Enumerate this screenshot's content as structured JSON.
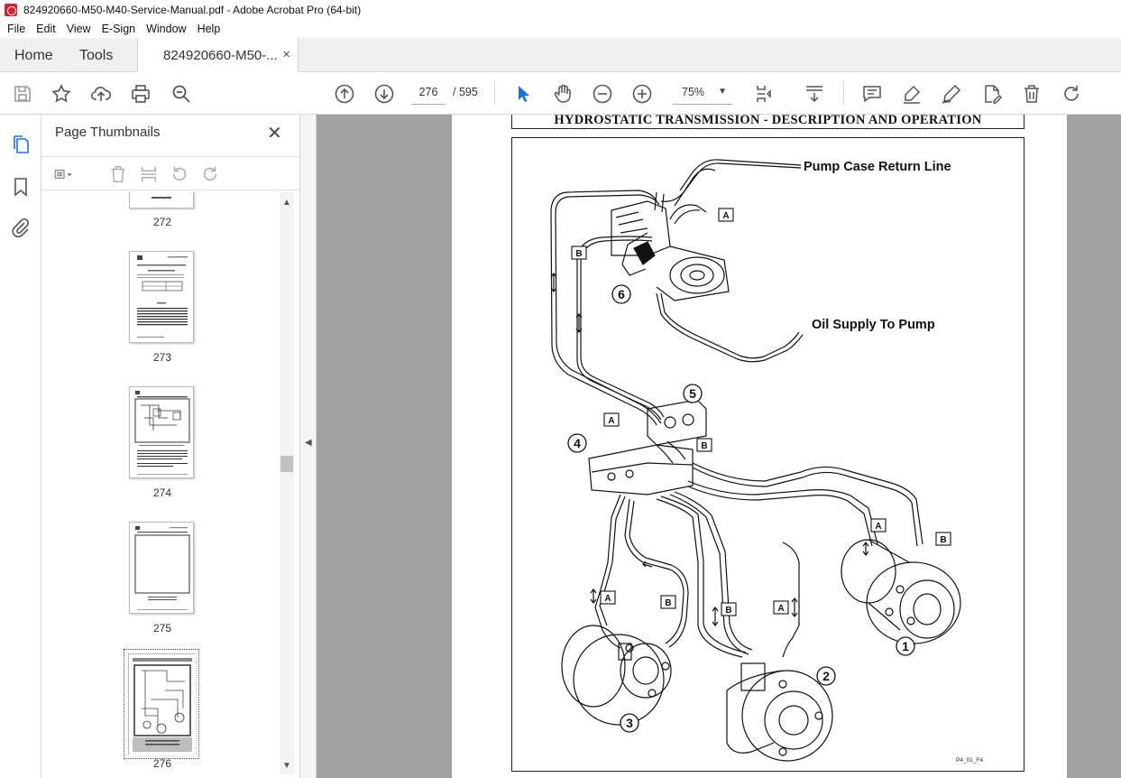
{
  "window": {
    "title": "824920660-M50-M40-Service-Manual.pdf - Adobe Acrobat Pro (64-bit)"
  },
  "menu": [
    "File",
    "Edit",
    "View",
    "E-Sign",
    "Window",
    "Help"
  ],
  "tabs": {
    "home": "Home",
    "tools": "Tools",
    "document": "824920660-M50-...",
    "close": "×"
  },
  "toolbar": {
    "current_page": "276",
    "total_pages": "/ 595",
    "zoom": "75%"
  },
  "thumbnails": {
    "title": "Page Thumbnails",
    "close": "✕",
    "pages": [
      "272",
      "273",
      "274",
      "275",
      "276"
    ],
    "selected": "276"
  },
  "document": {
    "header": "HYDROSTATIC TRANSMISSION - DESCRIPTION AND OPERATION",
    "labels": {
      "pump_case_return": "Pump Case Return Line",
      "oil_supply": "Oil Supply To Pump",
      "figure_code": "P4_01_F4"
    },
    "callouts": [
      "1",
      "2",
      "3",
      "4",
      "5",
      "6"
    ],
    "port_tags": [
      "A",
      "B"
    ]
  }
}
